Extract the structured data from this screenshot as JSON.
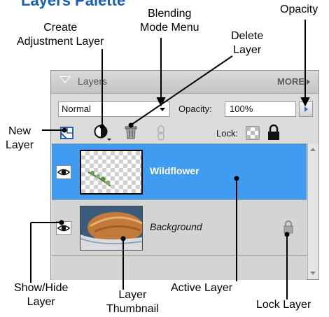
{
  "page_title": "Layers Palette",
  "callouts": {
    "opacity": "Opacity",
    "blending_mode_line1": "Blending",
    "blending_mode_line2": "Mode Menu",
    "create_adjustment_line1": "Create",
    "create_adjustment_line2": "Adjustment Layer",
    "delete_layer_line1": "Delete",
    "delete_layer_line2": "Layer",
    "new_layer_line1": "New",
    "new_layer_line2": "Layer",
    "show_hide_line1": "Show/Hide",
    "show_hide_line2": "Layer",
    "layer_thumbnail_line1": "Layer",
    "layer_thumbnail_line2": "Thumbnail",
    "active_layer": "Active Layer",
    "lock_layer": "Lock Layer"
  },
  "panel": {
    "tab_label": "Layers",
    "more_label": "MORE",
    "blend_mode_value": "Normal",
    "opacity_label": "Opacity:",
    "opacity_value": "100%",
    "lock_label": "Lock:"
  },
  "layers": [
    {
      "name": "Wildflower",
      "active": true,
      "visible": true,
      "locked": false
    },
    {
      "name": "Background",
      "active": false,
      "visible": true,
      "locked": true
    }
  ],
  "colors": {
    "title": "#1a5fb4",
    "active_row": "#3f9cf0",
    "panel_bg": "#dcdcdc"
  },
  "icons": [
    "new-layer-icon",
    "adjustment-layer-icon",
    "trash-icon",
    "link-icon",
    "lock-transparency-icon",
    "lock-icon",
    "eye-icon",
    "scroll-up-icon",
    "scroll-down-icon"
  ]
}
